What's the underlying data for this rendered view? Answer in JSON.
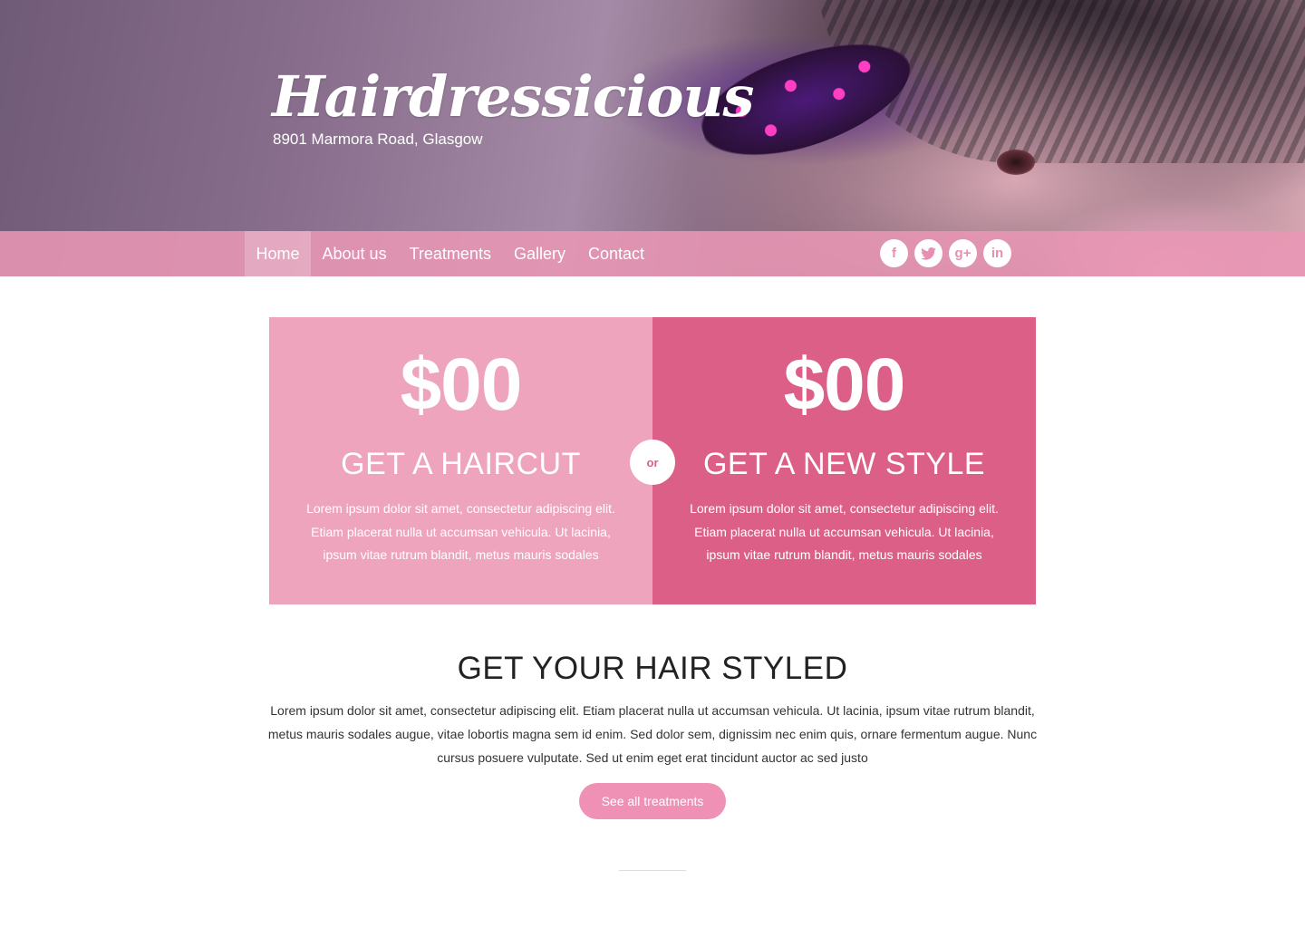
{
  "header": {
    "brand": "Hairdressicious",
    "address": "8901 Marmora Road, Glasgow"
  },
  "nav": {
    "items": [
      {
        "label": "Home",
        "active": true
      },
      {
        "label": "About us"
      },
      {
        "label": "Treatments"
      },
      {
        "label": "Gallery"
      },
      {
        "label": "Contact"
      }
    ],
    "social": [
      {
        "icon": "facebook-icon",
        "glyph": "f"
      },
      {
        "icon": "twitter-icon",
        "glyph": "t"
      },
      {
        "icon": "google-plus-icon",
        "glyph": "g+"
      },
      {
        "icon": "linkedin-icon",
        "glyph": "in"
      }
    ]
  },
  "offers": {
    "left": {
      "price": "$00",
      "title": "GET A HAIRCUT",
      "text": "Lorem ipsum dolor sit amet, consectetur adipiscing elit. Etiam placerat nulla ut accumsan vehicula. Ut lacinia, ipsum vitae rutrum blandit, metus mauris sodales"
    },
    "or": "or",
    "right": {
      "price": "$00",
      "title": "GET A NEW STYLE",
      "text": "Lorem ipsum dolor sit amet, consectetur adipiscing elit. Etiam placerat nulla ut accumsan vehicula. Ut lacinia, ipsum vitae rutrum blandit, metus mauris sodales"
    }
  },
  "styled": {
    "title": "GET YOUR HAIR STYLED",
    "text": "Lorem ipsum dolor sit amet, consectetur adipiscing elit. Etiam placerat nulla ut accumsan vehicula. Ut lacinia, ipsum vitae rutrum blandit, metus mauris sodales augue, vitae lobortis magna sem id enim. Sed dolor sem, dignissim nec enim quis, ornare fermentum augue. Nunc cursus posuere vulputate. Sed ut enim eget erat tincidunt auctor ac sed justo",
    "button": "See all treatments"
  },
  "colors": {
    "nav_bg": "#e896b4",
    "panel_light": "#eea4bc",
    "panel_dark": "#db5f86",
    "button": "#ee91b4"
  }
}
